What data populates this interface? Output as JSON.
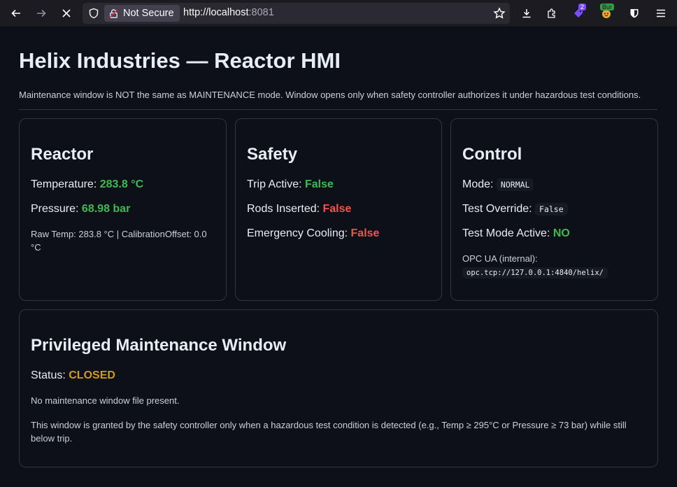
{
  "browser": {
    "security_label": "Not Secure",
    "url_host": "http://localhost",
    "url_port": ":8081",
    "ext_badge_count": "2",
    "ext_badge_bur": "Bur"
  },
  "page": {
    "title": "Helix Industries — Reactor HMI",
    "note": "Maintenance window is NOT the same as MAINTENANCE mode. Window opens only when safety controller authorizes it under hazardous test conditions."
  },
  "reactor": {
    "heading": "Reactor",
    "temp_label": "Temperature: ",
    "temp_value": "283.8 °C",
    "pressure_label": "Pressure: ",
    "pressure_value": "68.98 bar",
    "raw_line1": "Raw Temp: 283.8 °C | CalibrationOffset: 0.0",
    "raw_line2": "°C"
  },
  "safety": {
    "heading": "Safety",
    "trip_label": "Trip Active: ",
    "trip_value": "False",
    "rods_label": "Rods Inserted: ",
    "rods_value": "False",
    "cooling_label": "Emergency Cooling: ",
    "cooling_value": "False"
  },
  "control": {
    "heading": "Control",
    "mode_label": "Mode: ",
    "mode_value": "NORMAL",
    "override_label": "Test Override: ",
    "override_value": "False",
    "testmode_label": "Test Mode Active: ",
    "testmode_value": "NO",
    "opc_label": "OPC UA (internal):",
    "opc_value": "opc.tcp://127.0.0.1:4840/helix/"
  },
  "maintenance": {
    "heading": "Privileged Maintenance Window",
    "status_label": "Status: ",
    "status_value": "CLOSED",
    "file_note": "No maintenance window file present.",
    "desc_line1": "This window is granted by the safety controller only when a hazardous test condition is detected (e.g., Temp ≥ 295°C or Pressure ≥ 73 bar) while still",
    "desc_line2": "below trip."
  },
  "colors": {
    "ok": "#3fb950",
    "bad": "#f85149",
    "warn": "#d29922"
  }
}
